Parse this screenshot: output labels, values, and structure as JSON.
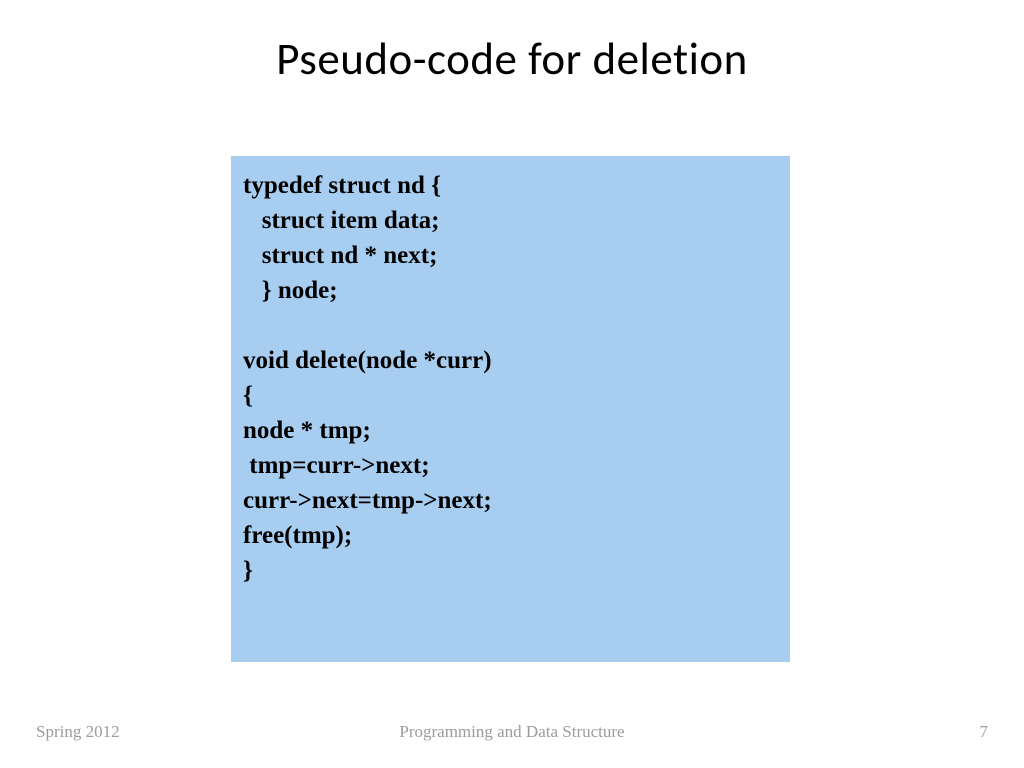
{
  "title": "Pseudo-code for deletion",
  "code": "typedef struct nd {\n   struct item data;\n   struct nd * next;\n   } node;\n\nvoid delete(node *curr)\n{\nnode * tmp;\n tmp=curr->next;\ncurr->next=tmp->next;\nfree(tmp);\n}",
  "footer": {
    "left": "Spring 2012",
    "center": "Programming and Data Structure",
    "page": "7"
  }
}
